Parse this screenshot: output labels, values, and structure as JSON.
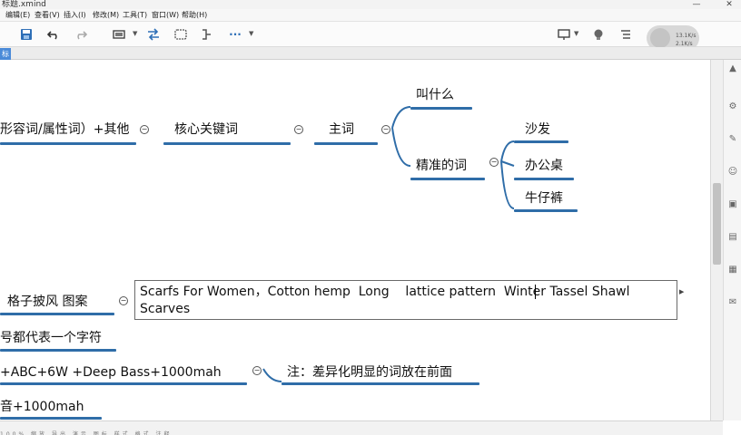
{
  "window": {
    "title": "标题.xmind",
    "minimize": "—",
    "close": "✕"
  },
  "menu": [
    "编辑(E)",
    "查看(V)",
    "插入(I)",
    "修改(M)",
    "工具(T)",
    "窗口(W)",
    "帮助(H)"
  ],
  "toolbar": {
    "net_up": "13.1K/s",
    "net_down": "2.1K/s",
    "more": "···"
  },
  "tab": {
    "label": "标"
  },
  "mindmap": {
    "row1_left": "形容词/属性词）+其他",
    "core_keyword": "核心关键词",
    "main_word": "主词",
    "what_called": "叫什么",
    "precise_word": "精准的词",
    "sofa": "沙发",
    "office_desk": "办公桌",
    "jeans": "牛仔裤",
    "plaid_cape": "格子披风  图案",
    "char_note": "号都代表一个字符",
    "abc_row": "+ABC+6W +Deep  Bass+1000mah",
    "note": "注：差异化明显的词放在前面",
    "bottom_row": "音+1000mah",
    "edit_text": "Scarfs For Women，Cotton hemp  Long    lattice pattern  Winter Tassel Shawl Scarves"
  },
  "collapse_symbol": "−",
  "status_fade": "100%   缩放   导出   演示   图标   样式   格式   注释"
}
